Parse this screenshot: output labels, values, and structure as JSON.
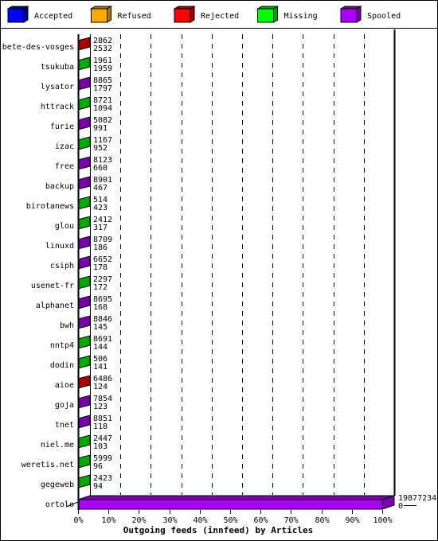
{
  "legend": [
    {
      "label": "Accepted",
      "color": "#0000ff",
      "side": "#000099"
    },
    {
      "label": "Refused",
      "color": "#ffaa00",
      "side": "#aa7700"
    },
    {
      "label": "Rejected",
      "color": "#ff0000",
      "side": "#aa0000"
    },
    {
      "label": "Missing",
      "color": "#00ff00",
      "side": "#00aa00"
    },
    {
      "label": "Spooled",
      "color": "#aa00ff",
      "side": "#7700aa"
    }
  ],
  "chart_data": {
    "type": "bar",
    "orientation": "horizontal",
    "title": "Outgoing feeds (innfeed) by Articles",
    "xlim": [
      0,
      100
    ],
    "x_ticks": [
      "0%",
      "10%",
      "20%",
      "30%",
      "40%",
      "50%",
      "60%",
      "70%",
      "80%",
      "90%",
      "100%"
    ],
    "grid": "vertical dashed",
    "legend_position": "top",
    "rows": [
      {
        "name": "bete-des-vosges",
        "top": "2862",
        "bottom": "2532",
        "series": "Rejected"
      },
      {
        "name": "tsukuba",
        "top": "1961",
        "bottom": "1959",
        "series": "Missing"
      },
      {
        "name": "lysator",
        "top": "8865",
        "bottom": "1797",
        "series": "Spooled"
      },
      {
        "name": "httrack",
        "top": "8721",
        "bottom": "1094",
        "series": "Missing"
      },
      {
        "name": "furie",
        "top": "5082",
        "bottom": "991",
        "series": "Spooled"
      },
      {
        "name": "izac",
        "top": "1167",
        "bottom": "952",
        "series": "Missing"
      },
      {
        "name": "free",
        "top": "8123",
        "bottom": "660",
        "series": "Spooled"
      },
      {
        "name": "backup",
        "top": "8901",
        "bottom": "467",
        "series": "Spooled"
      },
      {
        "name": "birotanews",
        "top": "514",
        "bottom": "423",
        "series": "Missing"
      },
      {
        "name": "glou",
        "top": "2412",
        "bottom": "317",
        "series": "Missing"
      },
      {
        "name": "linuxd",
        "top": "8709",
        "bottom": "186",
        "series": "Spooled"
      },
      {
        "name": "csiph",
        "top": "6652",
        "bottom": "178",
        "series": "Spooled"
      },
      {
        "name": "usenet-fr",
        "top": "2297",
        "bottom": "172",
        "series": "Missing"
      },
      {
        "name": "alphanet",
        "top": "8695",
        "bottom": "168",
        "series": "Spooled"
      },
      {
        "name": "bwh",
        "top": "8846",
        "bottom": "145",
        "series": "Spooled"
      },
      {
        "name": "nntp4",
        "top": "8691",
        "bottom": "144",
        "series": "Missing"
      },
      {
        "name": "dodin",
        "top": "506",
        "bottom": "141",
        "series": "Missing"
      },
      {
        "name": "aioe",
        "top": "6486",
        "bottom": "124",
        "series": "Rejected"
      },
      {
        "name": "goja",
        "top": "7854",
        "bottom": "123",
        "series": "Spooled"
      },
      {
        "name": "tnet",
        "top": "8851",
        "bottom": "118",
        "series": "Spooled"
      },
      {
        "name": "niel.me",
        "top": "2447",
        "bottom": "103",
        "series": "Missing"
      },
      {
        "name": "weretis.net",
        "top": "5999",
        "bottom": "96",
        "series": "Missing"
      },
      {
        "name": "gegeweb",
        "top": "2423",
        "bottom": "94",
        "series": "Missing"
      },
      {
        "name": "ortolo",
        "top": "19877234",
        "bottom": "0",
        "series": "Spooled",
        "percent": 100
      }
    ]
  }
}
